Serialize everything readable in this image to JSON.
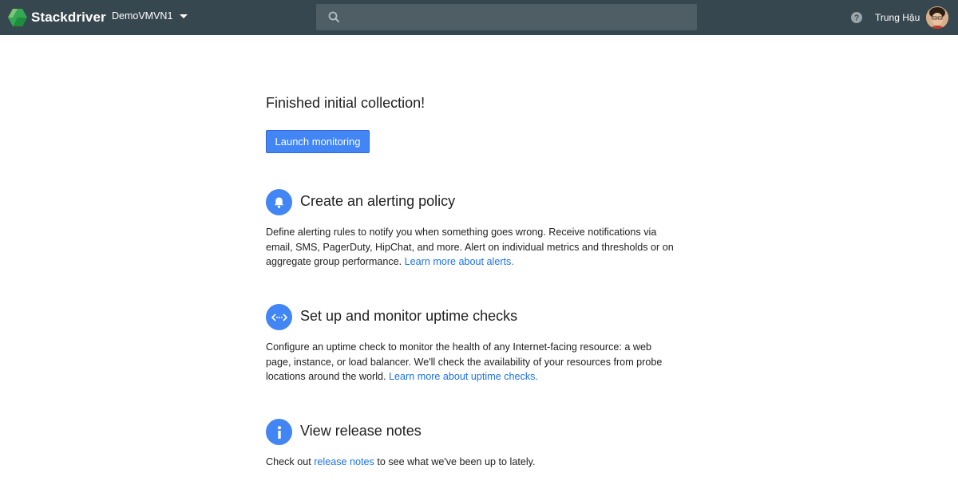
{
  "header": {
    "app_name": "Stackdriver",
    "project": "DemoVMVN1",
    "search_placeholder": "",
    "user_name": "Trung Hậu"
  },
  "main": {
    "title": "Finished initial collection!",
    "launch_button": "Launch monitoring",
    "sections": [
      {
        "icon": "bell-icon",
        "title": "Create an alerting policy",
        "text_lines": [
          "Define alerting rules to notify you when something goes wrong. Receive notifications via",
          "email, SMS, PagerDuty, HipChat, and more. Alert on individual metrics and thresholds or on",
          "aggregate group performance. "
        ],
        "link": "Learn more about alerts."
      },
      {
        "icon": "uptime-check-icon",
        "title": "Set up and monitor uptime checks",
        "text_lines": [
          "Configure an uptime check to monitor the health of any Internet-facing resource: a web",
          "page, instance, or load balancer. We'll check the availability of your resources from probe",
          "locations around the world. "
        ],
        "link": "Learn more about uptime checks."
      },
      {
        "icon": "info-icon",
        "title": "View release notes",
        "text_before": "Check out ",
        "link": "release notes",
        "text_after": " to see what we've been up to lately."
      }
    ]
  },
  "colors": {
    "topbar": "#37474f",
    "accent": "#4285f4",
    "link": "#1a73e8"
  }
}
